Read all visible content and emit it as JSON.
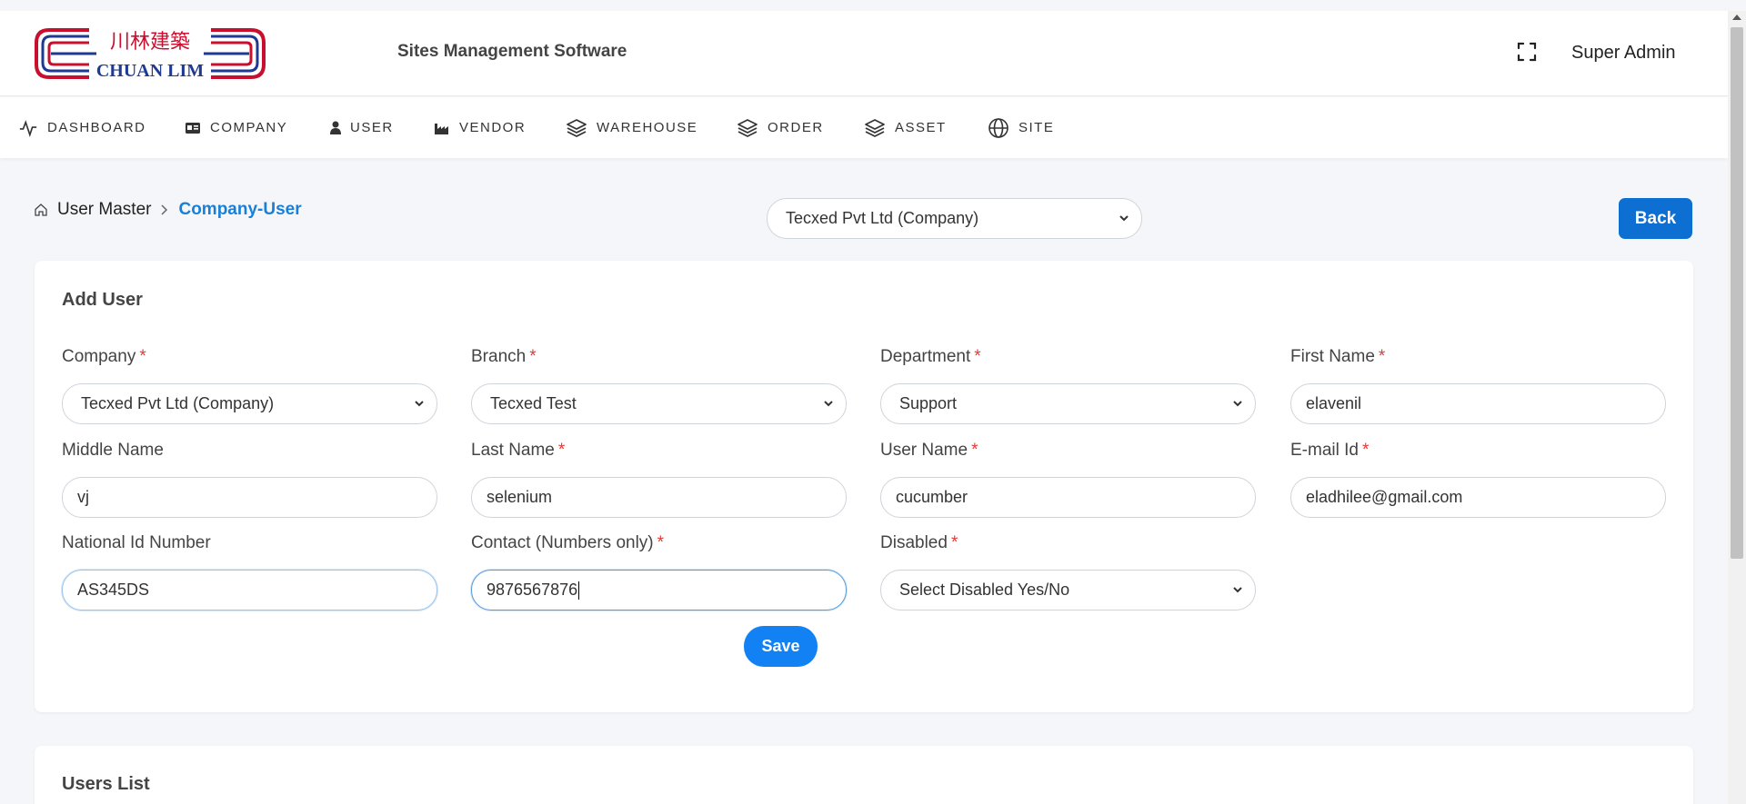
{
  "header": {
    "logo": {
      "chinese": "川林建築",
      "latin": "CHUAN LIM"
    },
    "app_title": "Sites Management Software",
    "user_name": "Super Admin",
    "icons": {
      "fullscreen": "fullscreen-icon"
    }
  },
  "nav": [
    {
      "label": "DASHBOARD",
      "icon": "activity-icon"
    },
    {
      "label": "COMPANY",
      "icon": "id-card-icon"
    },
    {
      "label": "USER",
      "icon": "user-icon"
    },
    {
      "label": "VENDOR",
      "icon": "factory-icon"
    },
    {
      "label": "WAREHOUSE",
      "icon": "layers-icon"
    },
    {
      "label": "ORDER",
      "icon": "layers-icon"
    },
    {
      "label": "ASSET",
      "icon": "layers-icon"
    },
    {
      "label": "SITE",
      "icon": "globe-icon"
    }
  ],
  "breadcrumb": {
    "home_icon": "home-icon",
    "master": "User Master",
    "current": "Company-User"
  },
  "company_filter": {
    "value": "Tecxed Pvt Ltd (Company)"
  },
  "back_label": "Back",
  "form": {
    "title": "Add User",
    "required_mark": "*",
    "company": {
      "label": "Company",
      "value": "Tecxed Pvt Ltd (Company)"
    },
    "branch": {
      "label": "Branch",
      "value": "Tecxed Test"
    },
    "department": {
      "label": "Department",
      "value": "Support"
    },
    "first_name": {
      "label": "First Name",
      "value": "elavenil"
    },
    "middle_name": {
      "label": "Middle Name",
      "value": "vj"
    },
    "last_name": {
      "label": "Last Name",
      "value": "selenium"
    },
    "user_name": {
      "label": "User Name",
      "value": "cucumber"
    },
    "email": {
      "label": "E-mail Id",
      "value": "eladhilee@gmail.com"
    },
    "national_id": {
      "label": "National Id Number",
      "value": "AS345DS"
    },
    "contact": {
      "label": "Contact (Numbers only)",
      "value": "9876567876"
    },
    "disabled": {
      "label": "Disabled",
      "value": "Select Disabled Yes/No"
    },
    "save_label": "Save"
  },
  "users_list": {
    "title": "Users List"
  },
  "colors": {
    "primary": "#1281f4",
    "back_button": "#0d6fd1",
    "link": "#1a7fd6",
    "required": "#e53935",
    "logo_red": "#c8102e",
    "logo_blue": "#1f3a93"
  }
}
